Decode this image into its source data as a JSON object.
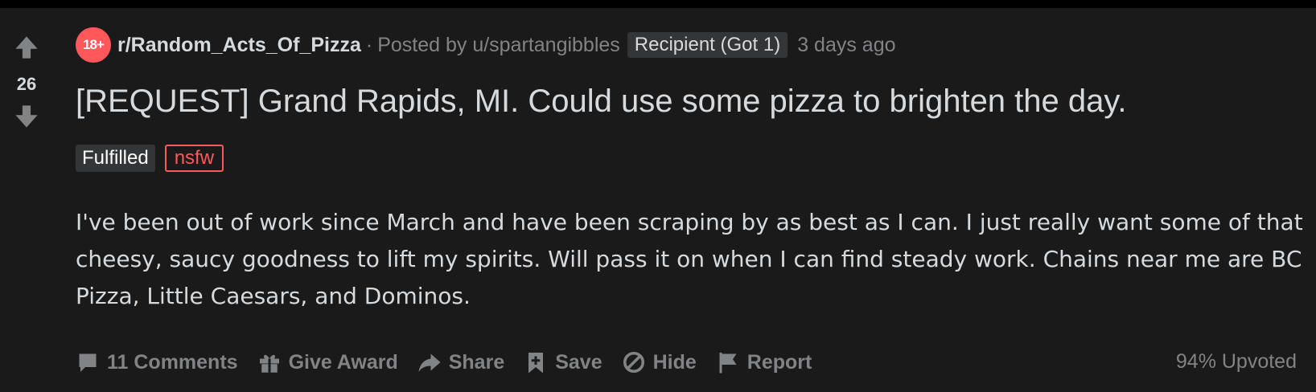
{
  "post": {
    "score": "26",
    "subreddit_icon_text": "18+",
    "subreddit": "r/Random_Acts_Of_Pizza",
    "separator": "·",
    "posted_by": "Posted by u/spartangibbles",
    "user_flair": "Recipient (Got 1)",
    "time": "3 days ago",
    "title": "[REQUEST] Grand Rapids, MI. Could use some pizza to brighten the day.",
    "flairs": {
      "fulfilled": "Fulfilled",
      "nsfw": "nsfw"
    },
    "body": "I've been out of work since March and have been scraping by as best as I can. I just really want some of that cheesy, saucy goodness to lift my spirits. Will pass it on when I can find steady work. Chains near me are BC Pizza, Little Caesars, and Dominos."
  },
  "actions": {
    "comments": "11 Comments",
    "give_award": "Give Award",
    "share": "Share",
    "save": "Save",
    "hide": "Hide",
    "report": "Report",
    "upvoted": "94% Upvoted"
  },
  "icons": {
    "upvote": "arrow-up-icon",
    "downvote": "arrow-down-icon",
    "comments": "comment-bubble-icon",
    "give_award": "gift-icon",
    "share": "share-arrow-icon",
    "save": "bookmark-plus-icon",
    "hide": "prohibit-icon",
    "report": "flag-icon"
  },
  "colors": {
    "background": "#1a1a1b",
    "text": "#d7dadc",
    "muted": "#818384",
    "nsfw": "#ff585b",
    "flair_bg": "#343536"
  }
}
